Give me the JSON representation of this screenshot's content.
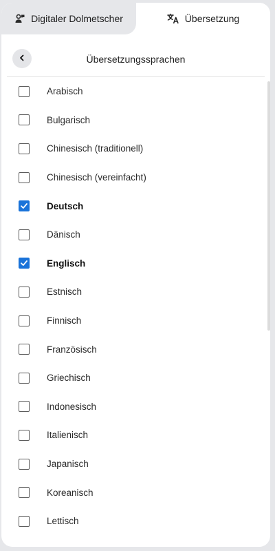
{
  "tabs": [
    {
      "label": "Digitaler Dolmetscher",
      "icon": "people-chat-icon",
      "active": false
    },
    {
      "label": "Übersetzung",
      "icon": "translate-icon",
      "active": true
    }
  ],
  "header": {
    "title": "Übersetzungssprachen",
    "back_icon": "chevron-left-icon"
  },
  "languages": [
    {
      "label": "Arabisch",
      "checked": false
    },
    {
      "label": "Bulgarisch",
      "checked": false
    },
    {
      "label": "Chinesisch (traditionell)",
      "checked": false
    },
    {
      "label": "Chinesisch (vereinfacht)",
      "checked": false
    },
    {
      "label": "Deutsch",
      "checked": true
    },
    {
      "label": "Dänisch",
      "checked": false
    },
    {
      "label": "Englisch",
      "checked": true
    },
    {
      "label": "Estnisch",
      "checked": false
    },
    {
      "label": "Finnisch",
      "checked": false
    },
    {
      "label": "Französisch",
      "checked": false
    },
    {
      "label": "Griechisch",
      "checked": false
    },
    {
      "label": "Indonesisch",
      "checked": false
    },
    {
      "label": "Italienisch",
      "checked": false
    },
    {
      "label": "Japanisch",
      "checked": false
    },
    {
      "label": "Koreanisch",
      "checked": false
    },
    {
      "label": "Lettisch",
      "checked": false
    }
  ],
  "colors": {
    "accent": "#1a73d9",
    "inactive_tab": "#e6e7ea"
  }
}
